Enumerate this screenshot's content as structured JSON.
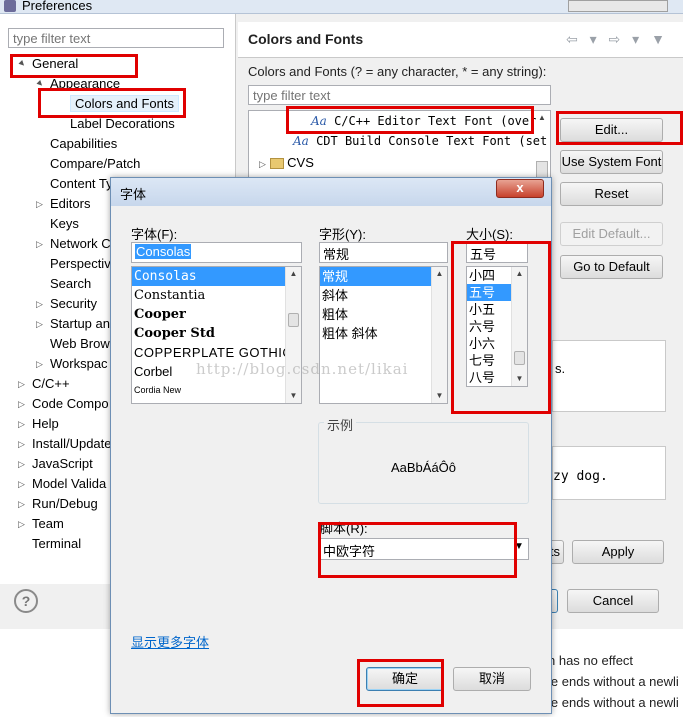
{
  "window": {
    "title": "Preferences"
  },
  "left": {
    "filter_placeholder": "type filter text",
    "tree": [
      {
        "label": "General",
        "indent": 0,
        "arrow": "▲"
      },
      {
        "label": "Appearance",
        "indent": 1,
        "arrow": "▲"
      },
      {
        "label": "Colors and Fonts",
        "indent": 2,
        "arrow": ""
      },
      {
        "label": "Label Decorations",
        "indent": 2,
        "arrow": ""
      },
      {
        "label": "Capabilities",
        "indent": 1,
        "arrow": ""
      },
      {
        "label": "Compare/Patch",
        "indent": 1,
        "arrow": ""
      },
      {
        "label": "Content Ty",
        "indent": 1,
        "arrow": ""
      },
      {
        "label": "Editors",
        "indent": 1,
        "arrow": "▷"
      },
      {
        "label": "Keys",
        "indent": 1,
        "arrow": ""
      },
      {
        "label": "Network C",
        "indent": 1,
        "arrow": "▷"
      },
      {
        "label": "Perspective",
        "indent": 1,
        "arrow": ""
      },
      {
        "label": "Search",
        "indent": 1,
        "arrow": ""
      },
      {
        "label": "Security",
        "indent": 1,
        "arrow": "▷"
      },
      {
        "label": "Startup an",
        "indent": 1,
        "arrow": "▷"
      },
      {
        "label": "Web Brow",
        "indent": 1,
        "arrow": ""
      },
      {
        "label": "Workspac",
        "indent": 1,
        "arrow": "▷"
      },
      {
        "label": "C/C++",
        "indent": 0,
        "arrow": "▷"
      },
      {
        "label": "Code Compo",
        "indent": 0,
        "arrow": "▷"
      },
      {
        "label": "Help",
        "indent": 0,
        "arrow": "▷"
      },
      {
        "label": "Install/Update",
        "indent": 0,
        "arrow": "▷"
      },
      {
        "label": "JavaScript",
        "indent": 0,
        "arrow": "▷"
      },
      {
        "label": "Model Valida",
        "indent": 0,
        "arrow": "▷"
      },
      {
        "label": "Run/Debug",
        "indent": 0,
        "arrow": "▷"
      },
      {
        "label": "Team",
        "indent": 0,
        "arrow": "▷"
      },
      {
        "label": "Terminal",
        "indent": 0,
        "arrow": ""
      }
    ],
    "help_icon": "?"
  },
  "right": {
    "title": "Colors and Fonts",
    "description": "Colors and Fonts (? = any character, * = any string):",
    "filter_placeholder": "type filter text",
    "font_items": [
      "C/C++ Editor Text Font (over",
      "CDT Build Console Text Font (set"
    ],
    "cvs_label": "CVS",
    "buttons": {
      "edit": "Edit...",
      "use_system_font": "Use System Font",
      "reset": "Reset",
      "edit_default": "Edit Default...",
      "go_to_default": "Go to Default",
      "apply": "Apply",
      "cancel": "Cancel",
      "hidden_apply_left": "ts"
    },
    "preview_fragment": "zy dog.",
    "preview_suffix": "s.",
    "background_lines": [
      "n has no effect",
      "le ends without a newli",
      "le ends without a newli"
    ]
  },
  "dialog": {
    "title": "字体",
    "close_label": "x",
    "font_label": "字体(F):",
    "font_value": "Consolas",
    "fonts": [
      "Consolas",
      "Constantia",
      "Cooper",
      "Cooper Std",
      "COPPERPLATE GOTHIC",
      "Corbel",
      "Cordia New"
    ],
    "style_label": "字形(Y):",
    "style_value": "常规",
    "styles": [
      "常规",
      "斜体",
      "粗体",
      "粗体 斜体"
    ],
    "size_label": "大小(S):",
    "size_value": "五号",
    "sizes": [
      "小四",
      "五号",
      "小五",
      "六号",
      "小六",
      "七号",
      "八号"
    ],
    "sample_label": "示例",
    "sample_text": "AaBbÁáÔô",
    "script_label": "脚本(R):",
    "script_value": "中欧字符",
    "more_fonts_link": "显示更多字体",
    "ok_button": "确定",
    "cancel_button": "取消",
    "watermark": "http://blog.csdn.net/likai"
  }
}
